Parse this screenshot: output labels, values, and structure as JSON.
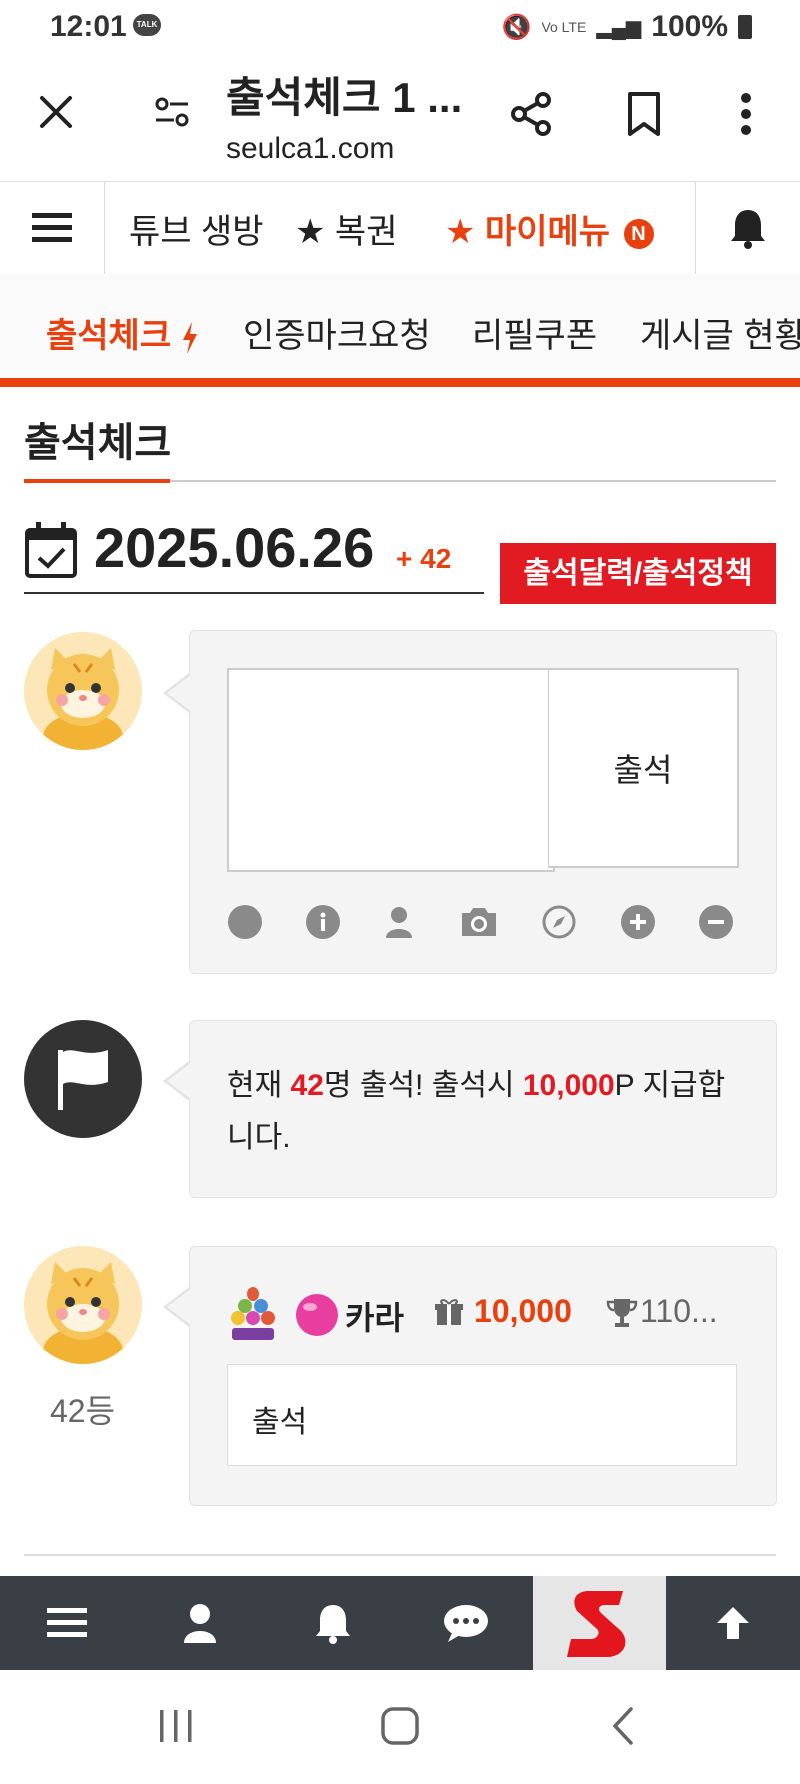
{
  "status_bar": {
    "time": "12:01",
    "talk_badge": "TALK",
    "signal_text": "Vo LTE",
    "battery": "100%"
  },
  "browser": {
    "title": "출석체크 1 ...",
    "url": "seulca1.com"
  },
  "site_header": {
    "items": [
      "튜브 생방",
      "★ 복권"
    ],
    "my_menu": "★ 마이메뉴",
    "new_badge": "N"
  },
  "tabs": [
    "출석체크",
    "인증마크요청",
    "리필쿠폰",
    "게시글 현황"
  ],
  "page": {
    "heading": "출석체크",
    "date": "2025.06.26",
    "date_count": "+ 42",
    "calendar_button": "출석달력/출석정책"
  },
  "compose": {
    "submit_label": "출석"
  },
  "notice": {
    "prefix": "현재 ",
    "count": "42",
    "middle": "명 출석! 출석시 ",
    "points": "10,000",
    "suffix": "P 지급합니다."
  },
  "entry": {
    "rank": "42등",
    "nickname": "카라",
    "points": "10,000",
    "trophy": "110...",
    "comment": "출석"
  },
  "colors": {
    "accent": "#e8410f",
    "red_button": "#e21b23",
    "bottom_bar": "#3a3f46"
  }
}
